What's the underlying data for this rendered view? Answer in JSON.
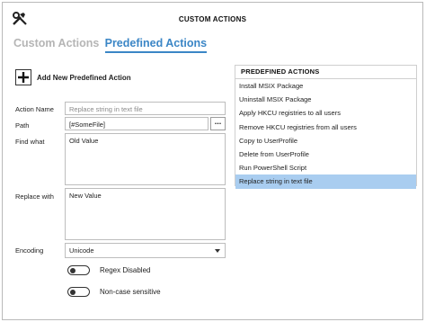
{
  "window": {
    "title": "CUSTOM ACTIONS",
    "icon": "tools-icon"
  },
  "tabs": [
    {
      "label": "Custom Actions",
      "active": false
    },
    {
      "label": "Predefined Actions",
      "active": true
    }
  ],
  "add_action": {
    "label": "Add New Predefined Action",
    "icon": "plus-icon"
  },
  "form": {
    "action_name": {
      "label": "Action Name",
      "placeholder": "Replace string in text file"
    },
    "path": {
      "label": "Path",
      "value": "[#SomeFile]",
      "browse_label": "..."
    },
    "find_what": {
      "label": "Find what",
      "value": "Old Value"
    },
    "replace_with": {
      "label": "Replace with",
      "value": "New Value"
    },
    "encoding": {
      "label": "Encoding",
      "value": "Unicode"
    },
    "regex_toggle": {
      "label": "Regex Disabled",
      "on": false
    },
    "case_toggle": {
      "label": "Non-case sensitive",
      "on": false
    }
  },
  "predefined": {
    "header": "PREDEFINED ACTIONS",
    "items": [
      "Install MSIX Package",
      "Uninstall MSIX Package",
      "Apply HKCU registries to all users",
      "Remove HKCU registries from all users",
      "Copy to UserProfile",
      "Delete from UserProfile",
      "Run PowerShell Script",
      "Replace string in text file"
    ],
    "selected_index": 7,
    "selected_color": "#a9cdf0"
  },
  "colors": {
    "accent": "#3b86c6",
    "inactive_tab": "#b5b5b5"
  }
}
